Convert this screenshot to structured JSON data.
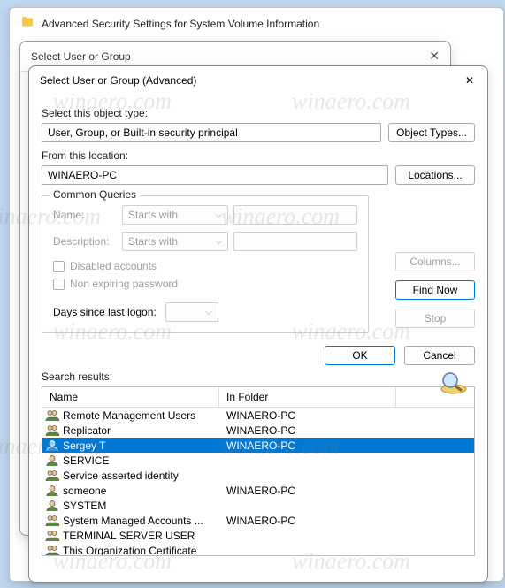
{
  "background_window": {
    "title": "Advanced Security Settings for System Volume Information"
  },
  "middle_window": {
    "title": "Select User or Group"
  },
  "dialog": {
    "title": "Select User or Group (Advanced)",
    "object_type_label": "Select this object type:",
    "object_type_value": "User, Group, or Built-in security principal",
    "object_types_btn": "Object Types...",
    "location_label": "From this location:",
    "location_value": "WINAERO-PC",
    "locations_btn": "Locations...",
    "common_queries_label": "Common Queries",
    "name_label": "Name:",
    "name_combo": "Starts with",
    "description_label": "Description:",
    "description_combo": "Starts with",
    "disabled_accounts": "Disabled accounts",
    "non_expiring": "Non expiring password",
    "days_since_label": "Days since last logon:",
    "columns_btn": "Columns...",
    "find_now_btn": "Find Now",
    "stop_btn": "Stop",
    "ok_btn": "OK",
    "cancel_btn": "Cancel",
    "search_results_label": "Search results:",
    "columns": {
      "name": "Name",
      "folder": "In Folder"
    },
    "rows": [
      {
        "type": "group",
        "name": "Remote Management Users",
        "folder": "WINAERO-PC",
        "selected": false
      },
      {
        "type": "group",
        "name": "Replicator",
        "folder": "WINAERO-PC",
        "selected": false
      },
      {
        "type": "user",
        "name": "Sergey T",
        "folder": "WINAERO-PC",
        "selected": true
      },
      {
        "type": "user",
        "name": "SERVICE",
        "folder": "",
        "selected": false
      },
      {
        "type": "group",
        "name": "Service asserted identity",
        "folder": "",
        "selected": false
      },
      {
        "type": "user",
        "name": "someone",
        "folder": "WINAERO-PC",
        "selected": false
      },
      {
        "type": "user",
        "name": "SYSTEM",
        "folder": "",
        "selected": false
      },
      {
        "type": "group",
        "name": "System Managed Accounts ...",
        "folder": "WINAERO-PC",
        "selected": false
      },
      {
        "type": "group",
        "name": "TERMINAL SERVER USER",
        "folder": "",
        "selected": false
      },
      {
        "type": "group",
        "name": "This Organization Certificate",
        "folder": "",
        "selected": false
      }
    ]
  },
  "watermark": "winaero.com"
}
